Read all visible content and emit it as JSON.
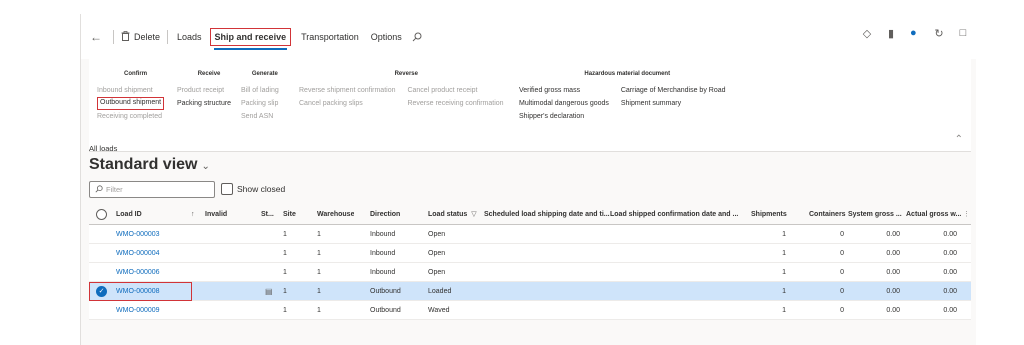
{
  "action_pane": {
    "back_icon": "back-arrow-icon",
    "delete_icon": "trash-icon",
    "delete_label": "Delete",
    "tabs": [
      "Loads",
      "Ship and receive",
      "Transportation",
      "Options"
    ],
    "active_tab": "Ship and receive",
    "search_icon": "search-icon",
    "right_icons": [
      "diamond-icon",
      "office-icon",
      "notification-icon",
      "refresh-icon",
      "popout-icon"
    ],
    "notification_badge": "0"
  },
  "ribbon": {
    "groups": [
      {
        "title": "Confirm",
        "columns": [
          [
            "Inbound shipment",
            "Outbound shipment",
            "Receiving completed"
          ]
        ]
      },
      {
        "title": "Receive",
        "columns": [
          [
            "Product receipt",
            "Packing structure"
          ]
        ]
      },
      {
        "title": "Generate",
        "columns": [
          [
            "Bill of lading",
            "Packing slip",
            "Send ASN"
          ]
        ]
      },
      {
        "title": "Reverse",
        "columns": [
          [
            "Reverse shipment confirmation",
            "Cancel packing slips"
          ],
          [
            "Cancel product receipt",
            "Reverse receiving confirmation"
          ]
        ]
      },
      {
        "title": "Hazardous material document",
        "columns": [
          [
            "Verified gross mass",
            "Multimodal dangerous goods",
            "Shipper's declaration"
          ],
          [
            "Carriage of Merchandise by Road",
            "Shipment summary"
          ]
        ]
      }
    ],
    "collapse_icon": "chevron-up-icon"
  },
  "content": {
    "breadcrumb": "All loads",
    "view_title": "Standard view",
    "view_chevron": "⌄",
    "filter_placeholder": "Filter",
    "show_closed_label": "Show closed"
  },
  "grid": {
    "headers": [
      "Load ID",
      "↑",
      "Invalid",
      "St...",
      "Site",
      "Warehouse",
      "Direction",
      "Load status",
      "Scheduled load shipping date and ti...",
      "Load shipped confirmation date and ...",
      "Shipments",
      "Containers",
      "System gross ...",
      "Actual gross w..."
    ],
    "rows": [
      {
        "id": "WMO-000003",
        "status_icon": "",
        "site": "1",
        "warehouse": "1",
        "direction": "Inbound",
        "load_status": "Open",
        "shipments": "1",
        "containers": "0",
        "system_gross": "0.00",
        "actual_gross": "0.00",
        "selected": false
      },
      {
        "id": "WMO-000004",
        "status_icon": "",
        "site": "1",
        "warehouse": "1",
        "direction": "Inbound",
        "load_status": "Open",
        "shipments": "1",
        "containers": "0",
        "system_gross": "0.00",
        "actual_gross": "0.00",
        "selected": false
      },
      {
        "id": "WMO-000006",
        "status_icon": "",
        "site": "1",
        "warehouse": "1",
        "direction": "Inbound",
        "load_status": "Open",
        "shipments": "1",
        "containers": "0",
        "system_gross": "0.00",
        "actual_gross": "0.00",
        "selected": false
      },
      {
        "id": "WMO-000008",
        "status_icon": "card-icon",
        "site": "1",
        "warehouse": "1",
        "direction": "Outbound",
        "load_status": "Loaded",
        "shipments": "1",
        "containers": "0",
        "system_gross": "0.00",
        "actual_gross": "0.00",
        "selected": true
      },
      {
        "id": "WMO-000009",
        "status_icon": "",
        "site": "1",
        "warehouse": "1",
        "direction": "Outbound",
        "load_status": "Waved",
        "shipments": "1",
        "containers": "0",
        "system_gross": "0.00",
        "actual_gross": "0.00",
        "selected": false
      }
    ]
  },
  "colors": {
    "accent": "#0f6cbd",
    "highlight": "#d13438",
    "selected_row": "#cfe4fa"
  }
}
